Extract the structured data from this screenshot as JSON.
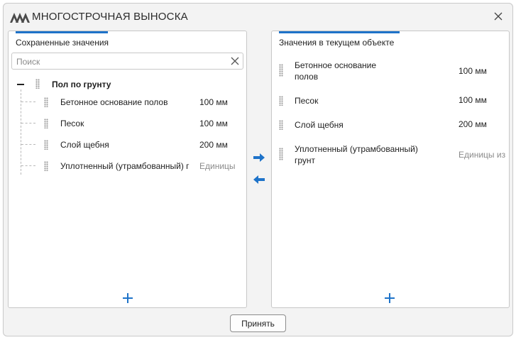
{
  "window": {
    "title": "МНОГОСТРОЧНАЯ ВЫНОСКА",
    "accent_color": "#1e73c9"
  },
  "left_panel": {
    "title": "Сохраненные значения",
    "search": {
      "placeholder": "Поиск",
      "value": ""
    },
    "group": {
      "label": "Пол по грунту",
      "expanded": true,
      "items": [
        {
          "label": "Бетонное основание полов",
          "value": "100 мм"
        },
        {
          "label": "Песок",
          "value": "100 мм"
        },
        {
          "label": "Слой щебня",
          "value": "200 мм"
        },
        {
          "label": "Уплотненный (утрамбованный) г",
          "value": "Единицы"
        }
      ]
    },
    "add_icon": "plus-icon"
  },
  "transfer": {
    "move_right_icon": "arrow-right-icon",
    "move_left_icon": "arrow-left-icon"
  },
  "right_panel": {
    "title": "Значения в текущем объекте",
    "items": [
      {
        "label": "Бетонное основание полов",
        "value": "100 мм"
      },
      {
        "label": "Песок",
        "value": "100 мм"
      },
      {
        "label": "Слой щебня",
        "value": "200 мм"
      },
      {
        "label": "Уплотненный (утрамбованный) грунт",
        "value": "Единицы из"
      }
    ],
    "add_icon": "plus-icon"
  },
  "footer": {
    "accept_label": "Принять"
  }
}
